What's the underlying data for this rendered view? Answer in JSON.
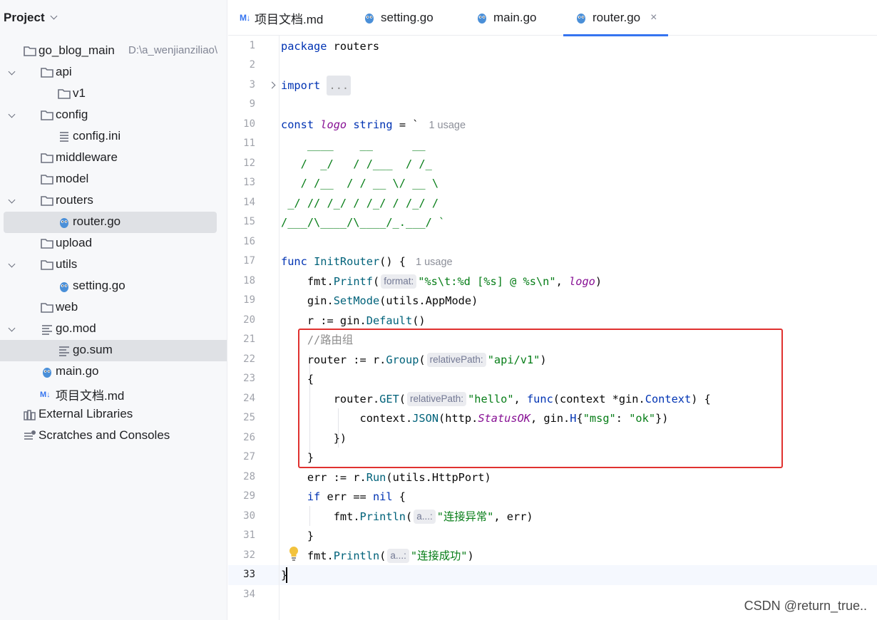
{
  "project": {
    "title": "Project",
    "tree": [
      {
        "label": "go_blog_main",
        "hint": "D:\\a_wenjianziliao\\",
        "icon": "folder-icon",
        "chevron": "down"
      },
      {
        "label": "api",
        "icon": "folder-icon",
        "chevron": "down"
      },
      {
        "label": "v1",
        "icon": "folder-icon",
        "chevron": ""
      },
      {
        "label": "config",
        "icon": "folder-icon",
        "chevron": "down"
      },
      {
        "label": "config.ini",
        "icon": "text-file-icon",
        "chevron": ""
      },
      {
        "label": "middleware",
        "icon": "folder-icon",
        "chevron": ""
      },
      {
        "label": "model",
        "icon": "folder-icon",
        "chevron": ""
      },
      {
        "label": "routers",
        "icon": "folder-icon",
        "chevron": "down"
      },
      {
        "label": "router.go",
        "icon": "go-gopher-icon",
        "chevron": ""
      },
      {
        "label": "upload",
        "icon": "folder-icon",
        "chevron": ""
      },
      {
        "label": "utils",
        "icon": "folder-icon",
        "chevron": "down"
      },
      {
        "label": "setting.go",
        "icon": "go-gopher-icon",
        "chevron": ""
      },
      {
        "label": "web",
        "icon": "folder-icon",
        "chevron": ""
      },
      {
        "label": "go.mod",
        "icon": "go-mod-icon",
        "chevron": "down"
      },
      {
        "label": "go.sum",
        "icon": "go-mod-icon",
        "chevron": ""
      },
      {
        "label": "main.go",
        "icon": "go-gopher-icon",
        "chevron": ""
      },
      {
        "label": "项目文档.md",
        "icon": "markdown-icon",
        "chevron": ""
      },
      {
        "label": "External Libraries",
        "icon": "library-icon",
        "chevron": "right"
      },
      {
        "label": "Scratches and Consoles",
        "icon": "scratches-icon",
        "chevron": ""
      }
    ]
  },
  "tabs": [
    {
      "label": "项目文档.md",
      "icon": "markdown-icon",
      "md_badge": "M↓"
    },
    {
      "label": "setting.go",
      "icon": "go-gopher-icon"
    },
    {
      "label": "main.go",
      "icon": "go-gopher-icon"
    },
    {
      "label": "router.go",
      "icon": "go-gopher-icon",
      "close": "×"
    }
  ],
  "line_numbers": [
    "1",
    "2",
    "3",
    "9",
    "10",
    "11",
    "12",
    "13",
    "14",
    "15",
    "16",
    "17",
    "18",
    "19",
    "20",
    "21",
    "22",
    "23",
    "24",
    "25",
    "26",
    "27",
    "28",
    "29",
    "30",
    "31",
    "32",
    "33",
    "34"
  ],
  "code": {
    "l1_kw": "package",
    "l1_name": " routers",
    "l3_kw": "import",
    "l3_fold": "...",
    "l10_kw": "const",
    "l10_name": "logo",
    "l10_type": "string",
    "l10_rest": " = `",
    "l10_usage": "1 usage",
    "l11": "    ____    __      __",
    "l12": "   /  _/   / /___  / /_",
    "l13": "   / /__  / / __ \\/ __ \\",
    "l14": " _/ // /_/ / /_/ / /_/ /",
    "l15": "/___/\\____/\\____/_.___/ `",
    "l17_kw": "func",
    "l17_fn": "InitRouter",
    "l17_rest": "() {",
    "l17_usage": "1 usage",
    "l18_pkg": "fmt",
    "l18_call": "Printf",
    "l18_hint": "format:",
    "l18_str": "\"%s\\t:%d [%s] @ %s\\n\"",
    "l18_arg": "logo",
    "l19_pkg": "gin",
    "l19_call": "SetMode",
    "l19_args": "(utils.AppMode)",
    "l20_var": "r := gin.",
    "l20_call": "Default",
    "l20_rest": "()",
    "l21_cmt": "//路由组",
    "l22_var": "router := r.",
    "l22_call": "Group",
    "l22_hint": "relativePath:",
    "l22_str": "\"api/v1\"",
    "l23": "{",
    "l24_var": "router.",
    "l24_call": "GET",
    "l24_hint": "relativePath:",
    "l24_str": "\"hello\"",
    "l24_kw": "func",
    "l24_rest1": "(context *gin.",
    "l24_type": "Context",
    "l24_rest2": ") {",
    "l25_var": "context.",
    "l25_call": "JSON",
    "l25_pkg": "(http.",
    "l25_const": "StatusOK",
    "l25_rest1": ", gin.",
    "l25_h": "H",
    "l25_str1": "\"msg\"",
    "l25_str2": "\"ok\"",
    "l26": "})",
    "l27": "}",
    "l28_var": "err := r.",
    "l28_call": "Run",
    "l28_args": "(utils.HttpPort)",
    "l29_kw": "if",
    "l29_mid": " err == ",
    "l29_nil": "nil",
    "l29_end": " {",
    "l30_pkg": "fmt",
    "l30_call": "Println",
    "l30_hint": "a...:",
    "l30_str": "\"连接异常\"",
    "l30_end": ", err)",
    "l31": "}",
    "l32_pkg": "fmt",
    "l32_call": "Println",
    "l32_hint": "a...:",
    "l32_str": "\"连接成功\"",
    "l32_end": ")",
    "l33": "}"
  },
  "watermark": "CSDN @return_true.."
}
